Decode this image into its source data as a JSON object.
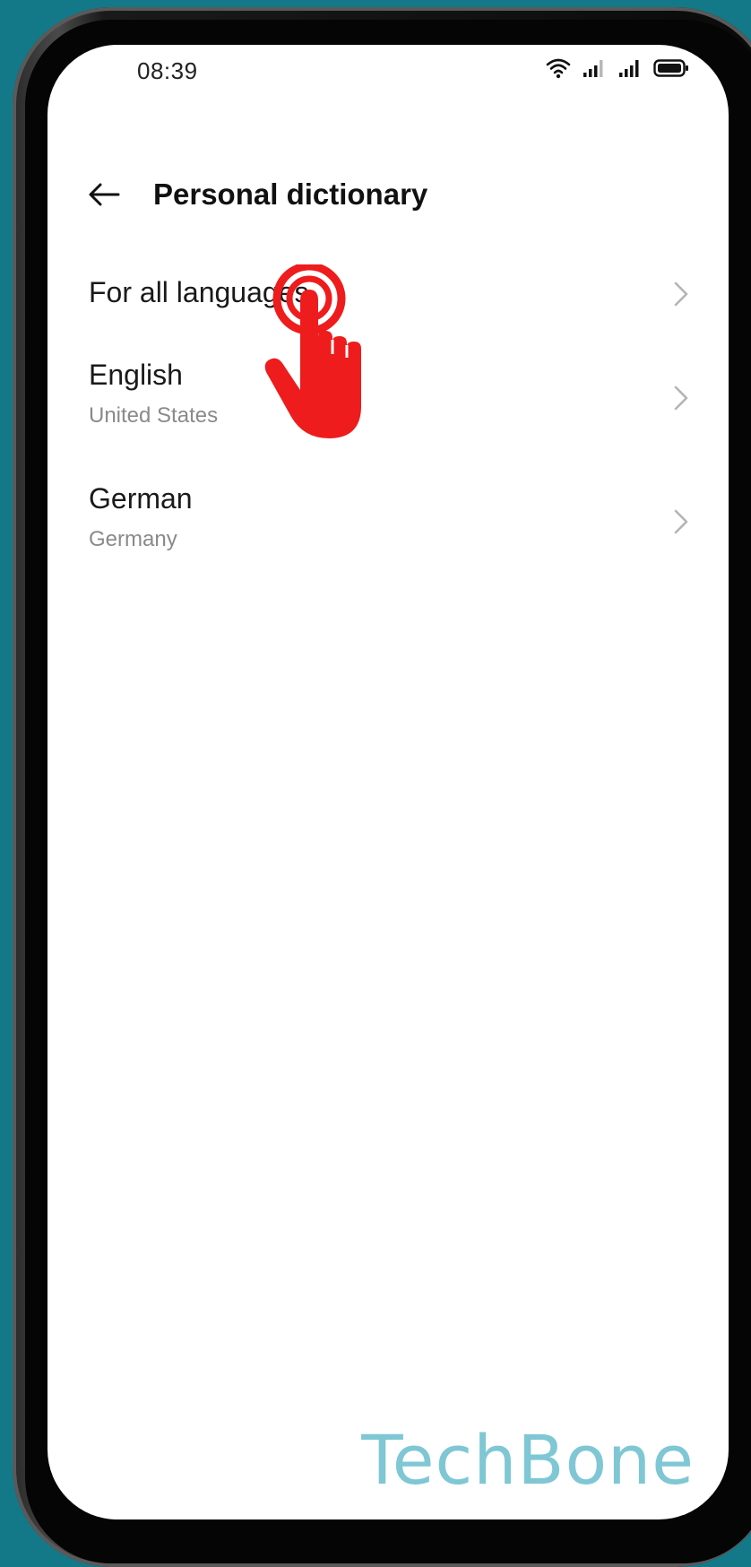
{
  "status_bar": {
    "time": "08:39",
    "icons": [
      "wifi-icon",
      "signal-icon",
      "signal-icon",
      "battery-icon"
    ]
  },
  "header": {
    "back_icon": "arrow-left-icon",
    "title": "Personal dictionary"
  },
  "list": {
    "items": [
      {
        "title": "For all languages",
        "subtitle": null,
        "chevron": "chevron-right-icon"
      },
      {
        "title": "English",
        "subtitle": "United States",
        "chevron": "chevron-right-icon"
      },
      {
        "title": "German",
        "subtitle": "Germany",
        "chevron": "chevron-right-icon"
      }
    ]
  },
  "overlay": {
    "touch_icon": "tap-hand-icon",
    "touch_color": "#ee1c1c"
  },
  "watermark": {
    "text": "TechBone"
  },
  "colors": {
    "background": "#137989",
    "watermark": "#7fc7d4"
  }
}
